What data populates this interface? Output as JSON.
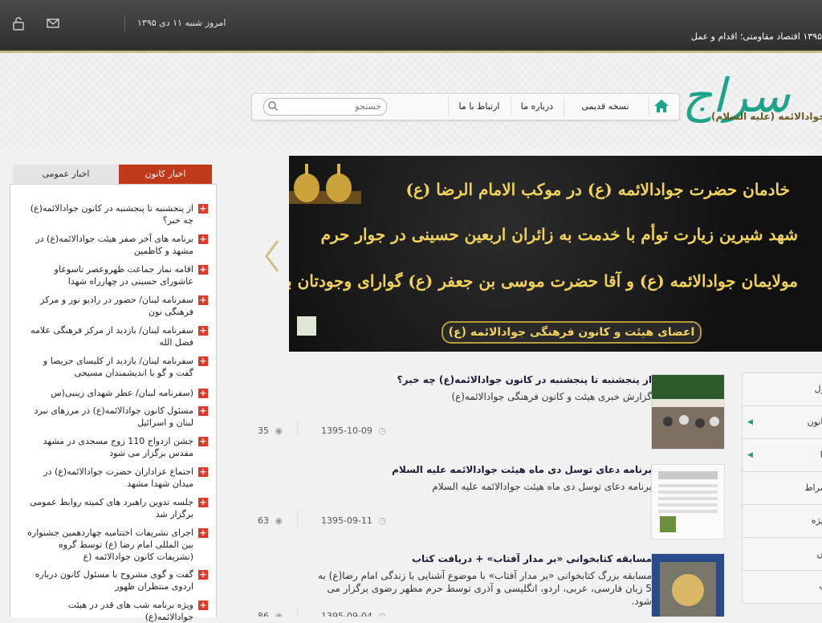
{
  "topbar": {
    "ticker": "۱۳۹۵ اقتصاد مقاومتی؛ اقدام و عمل",
    "date": "امروز شنبه ۱۱ دی ۱۳۹۵",
    "icons": [
      "mail-icon",
      "lock-icon"
    ]
  },
  "header": {
    "logo_mark": "سراج",
    "logo_name": "کانون جوادالائمه (علیه السلام)",
    "nav": {
      "home_icon": "home-icon",
      "items": [
        "نسخه قدیمی",
        "درباره ما",
        "ارتباط با ما"
      ],
      "search_placeholder": "جستجو"
    }
  },
  "news": {
    "tabs": [
      "اخبار کانون",
      "اخبار عمومی"
    ],
    "items": [
      "از پنجشنبه تا پنجشنبه در کانون جوادالائمه(ع) چه خبر؟",
      "برنامه های آخر صفر هیئت جوادالائمه(ع) در مشهد و کاظمین",
      "اقامه نماز جماعت ظهروعصر تاسوعاو عاشورای حسینی در چهارراه شهدا",
      "سفرنامه لبنان/ حضور در رادیو نور و مرکز فرهنگی نون",
      "سفرنامه لبنان/ بازدید از مرکز فرهنگی علامه فضل الله",
      "سفرنامه لبنان/ بازدید از کلیسای حریصا و گفت و گو با اندیشمندان مسیحی",
      "(سفرنامه لبنان/ عطر شهدای زینبی(س",
      "مسئول کانون جوادالائمه(ع) در مرزهای نبرد لبنان و اسرائیل",
      "جشن ازدواج 110 زوج مسجدی در مشهد مقدس برگزار می شود",
      "اجتماع عزاداران حضرت جوادالائمه(ع) در میدان شهدا مشهد",
      "جلسه تدوین راهبرد های کمیته روابط عمومی برگزار شد",
      "اجرای تشریفات اختتامیه چهاردهمین جشنواره بین المللی امام رضا (ع) توسط گروه (تشریفات کانون جوادالائمه (ع",
      "گفت و گوی مشروح با مسئول کانون درباره اردوی منتظران ظهور",
      "ویژه برنامه شب های قدر در هیئت جوادالائمه(ع)"
    ]
  },
  "slider": {
    "lines": [
      "خادمان حضرت جوادالائمه (ع) در موکب الامام الرضا (ع)",
      "شهد شیرین زیارت توأم با خدمت به زائران اربعین حسینی در جوار حرم",
      "مولایمان جوادالائمه (ع) و آقا حضرت موسی بن جعفر (ع) گوارای وجودتان باد"
    ],
    "banner": "اعضای هیئت و کانون فرهنگی جوادالائمه (ع)",
    "prev_icon": "chevron-left-icon"
  },
  "articles": [
    {
      "title": "از پنجشنبه تا پنجشنبه در کانون جوادالائمه(ع) چه خبر؟",
      "desc": "گزارش خبری هیئت و کانون فرهنگی جوادالائمه(ع)",
      "date": "1395-10-09",
      "views": "35"
    },
    {
      "title": "برنامه دعای توسل دی ماه هیئت جوادالائمه علیه السلام",
      "desc": "برنامه دعای توسل دی ماه هیئت جوادالائمه علیه السلام",
      "date": "1395-09-11",
      "views": "63"
    },
    {
      "title": "مسابقه کتابخوانی «بر مدار آفتاب» + دریافت کتاب",
      "desc": "مسابقه بزرگ کتابخوانی «بر مدار آفتاب» با موضوع آشنایی با زندگی امام رضا(ع) به 5 زبان فارسی، عربی، اردو، انگلیسی و آذری توسط حرم مطهر رضوی برگزار می شود.",
      "date": "1395-09-04",
      "views": "86"
    }
  ],
  "right_menu": {
    "items": [
      "اول",
      "کانون",
      "ما",
      "صراط",
      "ویژه",
      "س",
      "ت"
    ]
  },
  "colors": {
    "accent_red": "#c0391b",
    "brand_green": "#1ea38b",
    "gold": "#f2d35a"
  }
}
